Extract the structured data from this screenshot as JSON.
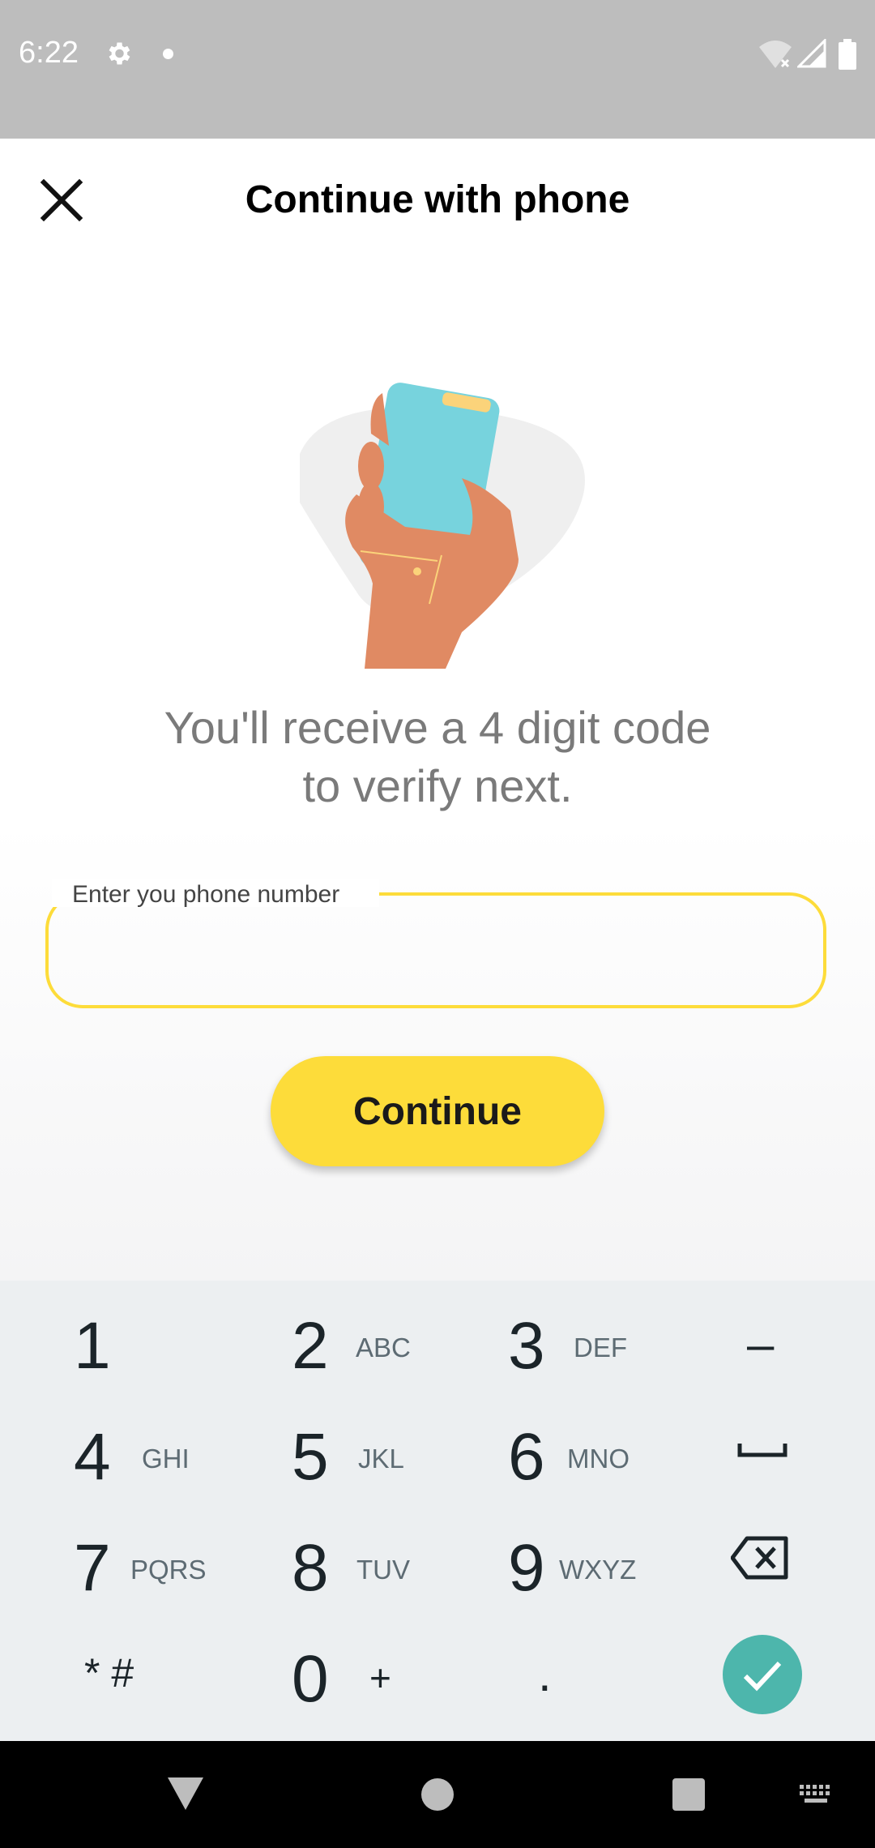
{
  "status_bar": {
    "time": "6:22",
    "icons": [
      "gear-icon",
      "notification-dot-icon",
      "wifi-off-icon",
      "signal-icon",
      "battery-icon"
    ]
  },
  "header": {
    "title": "Continue with phone",
    "close_icon": "close-icon"
  },
  "main": {
    "illustration": "hand-holding-phone",
    "info_text": "You'll receive a 4 digit code\nto verify next.",
    "phone_field": {
      "label": "Enter you phone number",
      "value": "",
      "placeholder": ""
    },
    "continue_label": "Continue"
  },
  "keypad": {
    "keys": [
      {
        "digit": "1",
        "letters": ""
      },
      {
        "digit": "2",
        "letters": "ABC"
      },
      {
        "digit": "3",
        "letters": "DEF"
      },
      {
        "digit": "4",
        "letters": "GHI"
      },
      {
        "digit": "5",
        "letters": "JKL"
      },
      {
        "digit": "6",
        "letters": "MNO"
      },
      {
        "digit": "7",
        "letters": "PQRS"
      },
      {
        "digit": "8",
        "letters": "TUV"
      },
      {
        "digit": "9",
        "letters": "WXYZ"
      },
      {
        "digit": "0",
        "letters": "+"
      }
    ],
    "dash": "–",
    "star_hash": "* #",
    "dot": ".",
    "space_icon": "space-bar-icon",
    "backspace_icon": "backspace-icon",
    "done_icon": "check-icon"
  },
  "nav_bar": {
    "icons": [
      "back-triangle-icon",
      "home-circle-icon",
      "recents-square-icon",
      "keyboard-icon"
    ]
  },
  "colors": {
    "accent": "#fddc3a",
    "done": "#4db6ac",
    "status_bar": "#bdbdbd",
    "keypad_bg": "#eceff1"
  }
}
